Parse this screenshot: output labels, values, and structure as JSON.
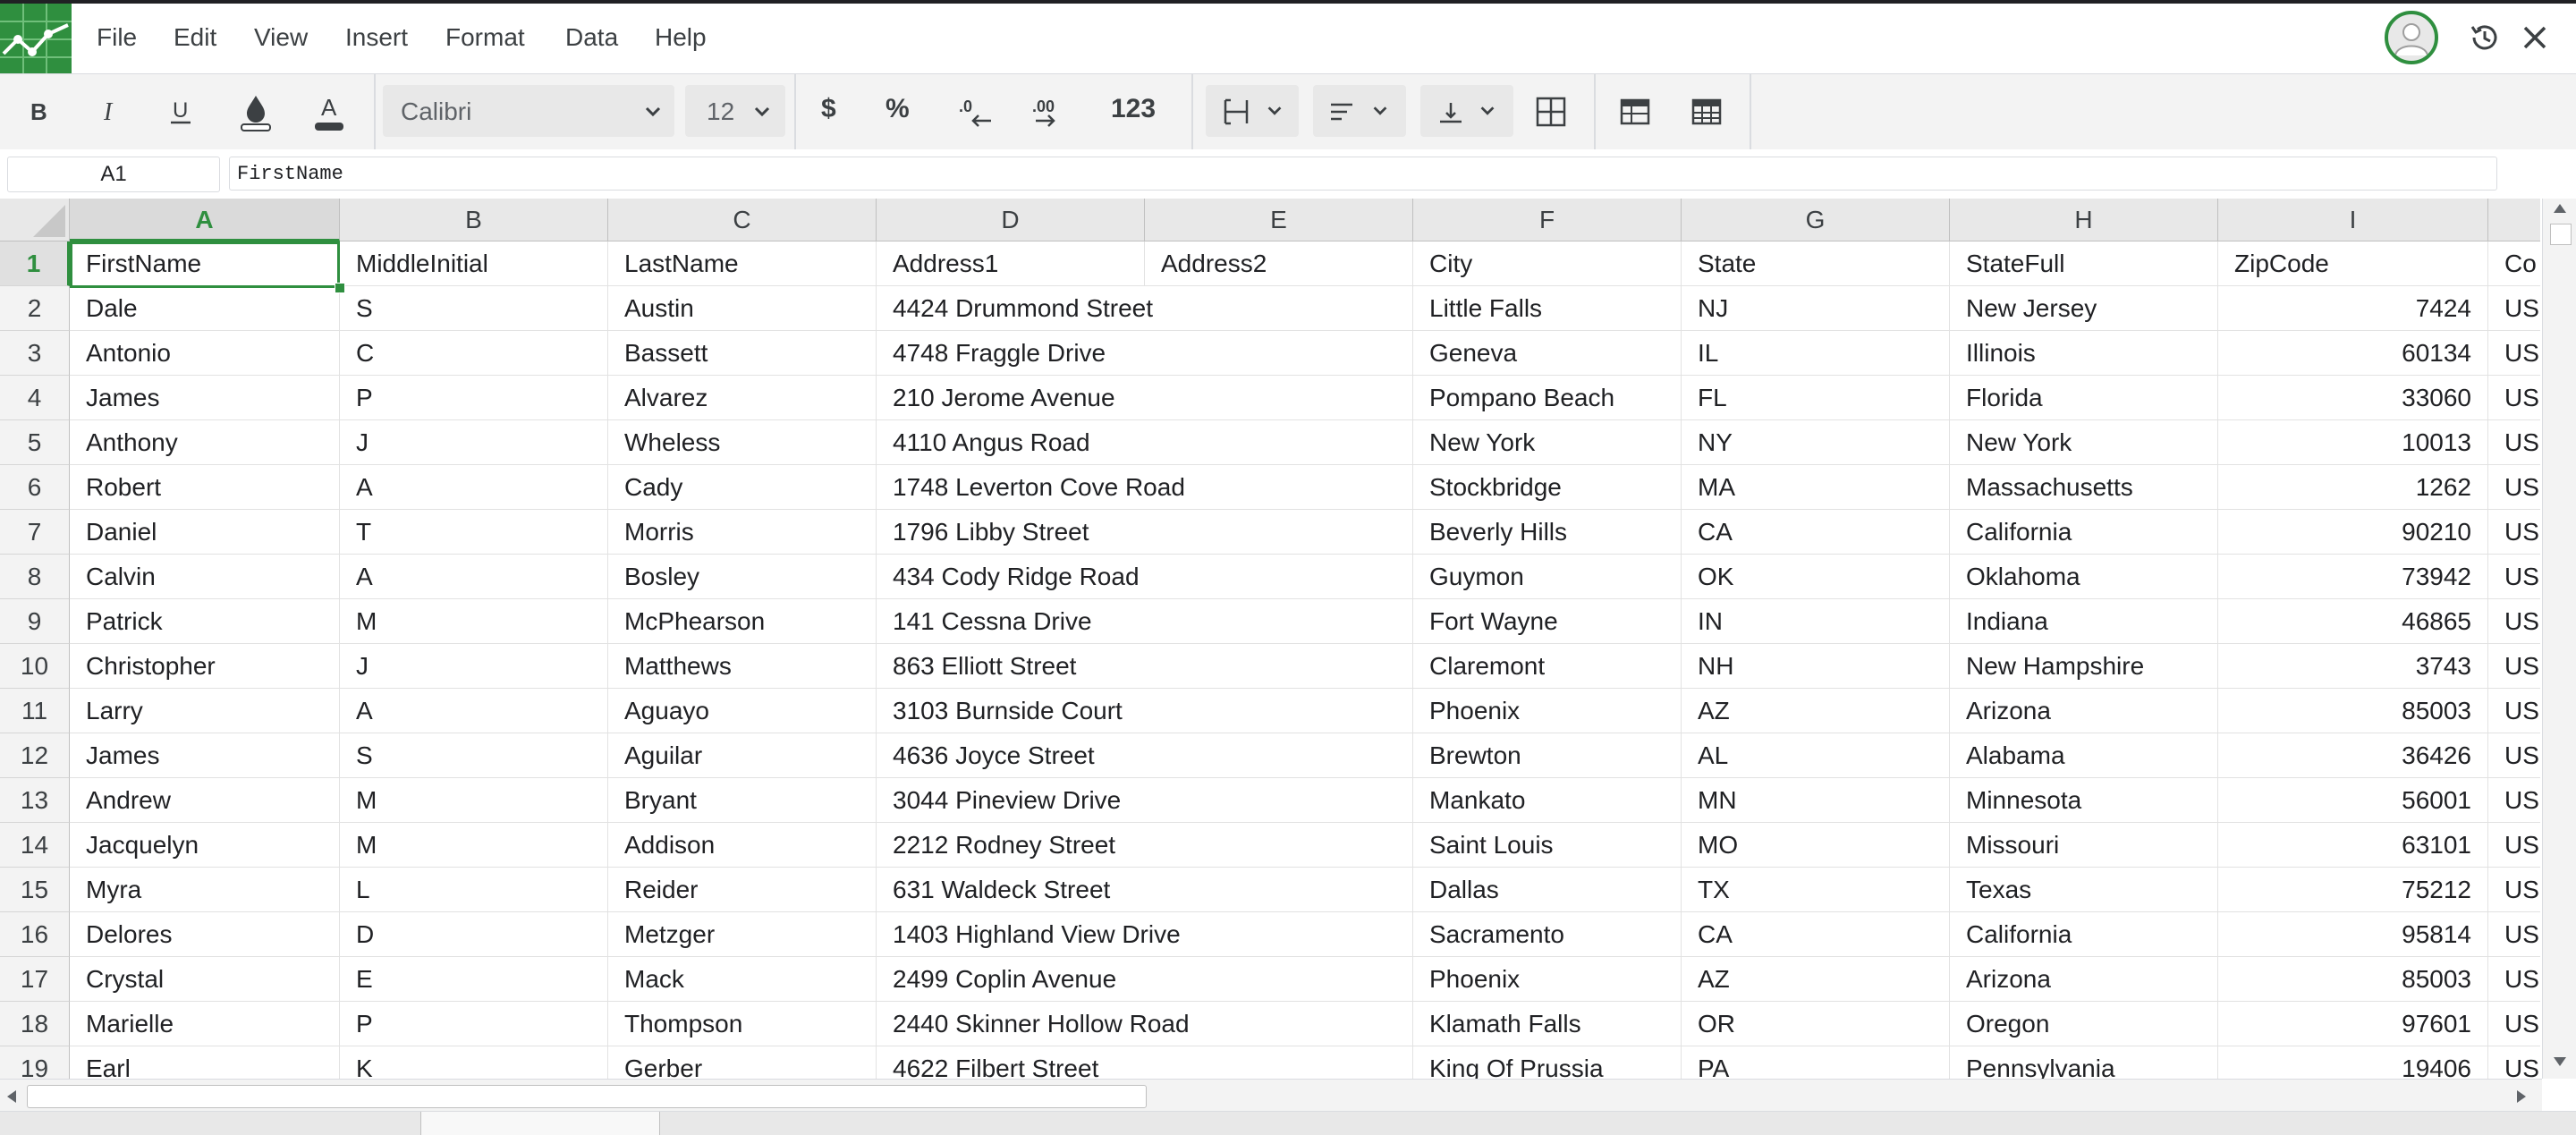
{
  "menu": {
    "items": [
      "File",
      "Edit",
      "View",
      "Insert",
      "Format",
      "Data",
      "Help"
    ]
  },
  "toolbar": {
    "font_name": "Calibri",
    "font_size": "12",
    "currency_label": "$",
    "percent_label": "%",
    "number_format_label": "123"
  },
  "formula_bar": {
    "cell_ref": "A1",
    "content": "FirstName"
  },
  "grid": {
    "columns": [
      "A",
      "B",
      "C",
      "D",
      "E",
      "F",
      "G",
      "H",
      "I"
    ],
    "selected_column": "A",
    "rows": [
      {
        "n": "1",
        "c": [
          "FirstName",
          "MiddleInitial",
          "LastName",
          "Address1",
          "Address2",
          "City",
          "State",
          "StateFull",
          "ZipCode",
          "Co"
        ]
      },
      {
        "n": "2",
        "c": [
          "Dale",
          "S",
          "Austin",
          "4424 Drummond Street",
          "",
          "Little Falls",
          "NJ",
          "New Jersey",
          "7424",
          "US"
        ]
      },
      {
        "n": "3",
        "c": [
          "Antonio",
          "C",
          "Bassett",
          "4748 Fraggle Drive",
          "",
          "Geneva",
          "IL",
          "Illinois",
          "60134",
          "US"
        ]
      },
      {
        "n": "4",
        "c": [
          "James",
          "P",
          "Alvarez",
          "210 Jerome Avenue",
          "",
          "Pompano Beach",
          "FL",
          "Florida",
          "33060",
          "US"
        ]
      },
      {
        "n": "5",
        "c": [
          "Anthony",
          "J",
          "Wheless",
          "4110 Angus Road",
          "",
          "New York",
          "NY",
          "New York",
          "10013",
          "US"
        ]
      },
      {
        "n": "6",
        "c": [
          "Robert",
          "A",
          "Cady",
          "1748 Leverton Cove Road",
          "",
          "Stockbridge",
          "MA",
          "Massachusetts",
          "1262",
          "US"
        ]
      },
      {
        "n": "7",
        "c": [
          "Daniel",
          "T",
          "Morris",
          "1796 Libby Street",
          "",
          "Beverly Hills",
          "CA",
          "California",
          "90210",
          "US"
        ]
      },
      {
        "n": "8",
        "c": [
          "Calvin",
          "A",
          "Bosley",
          "434 Cody Ridge Road",
          "",
          "Guymon",
          "OK",
          "Oklahoma",
          "73942",
          "US"
        ]
      },
      {
        "n": "9",
        "c": [
          "Patrick",
          "M",
          "McPhearson",
          "141 Cessna Drive",
          "",
          "Fort Wayne",
          "IN",
          "Indiana",
          "46865",
          "US"
        ]
      },
      {
        "n": "10",
        "c": [
          "Christopher",
          "J",
          "Matthews",
          "863 Elliott Street",
          "",
          "Claremont",
          "NH",
          "New Hampshire",
          "3743",
          "US"
        ]
      },
      {
        "n": "11",
        "c": [
          "Larry",
          "A",
          "Aguayo",
          "3103 Burnside Court",
          "",
          "Phoenix",
          "AZ",
          "Arizona",
          "85003",
          "US"
        ]
      },
      {
        "n": "12",
        "c": [
          "James",
          "S",
          "Aguilar",
          "4636 Joyce Street",
          "",
          "Brewton",
          "AL",
          "Alabama",
          "36426",
          "US"
        ]
      },
      {
        "n": "13",
        "c": [
          "Andrew",
          "M",
          "Bryant",
          "3044 Pineview Drive",
          "",
          "Mankato",
          "MN",
          "Minnesota",
          "56001",
          "US"
        ]
      },
      {
        "n": "14",
        "c": [
          "Jacquelyn",
          "M",
          "Addison",
          "2212 Rodney Street",
          "",
          "Saint Louis",
          "MO",
          "Missouri",
          "63101",
          "US"
        ]
      },
      {
        "n": "15",
        "c": [
          "Myra",
          "L",
          "Reider",
          "631 Waldeck Street",
          "",
          "Dallas",
          "TX",
          "Texas",
          "75212",
          "US"
        ]
      },
      {
        "n": "16",
        "c": [
          "Delores",
          "D",
          "Metzger",
          "1403 Highland View Drive",
          "",
          "Sacramento",
          "CA",
          "California",
          "95814",
          "US"
        ]
      },
      {
        "n": "17",
        "c": [
          "Crystal",
          "E",
          "Mack",
          "2499 Coplin Avenue",
          "",
          "Phoenix",
          "AZ",
          "Arizona",
          "85003",
          "US"
        ]
      },
      {
        "n": "18",
        "c": [
          "Marielle",
          "P",
          "Thompson",
          "2440 Skinner Hollow Road",
          "",
          "Klamath Falls",
          "OR",
          "Oregon",
          "97601",
          "US"
        ]
      },
      {
        "n": "19",
        "c": [
          "Earl",
          "K",
          "Gerber",
          "4622 Filbert Street",
          "",
          "King Of Prussia",
          "PA",
          "Pennsylvania",
          "19406",
          "US"
        ]
      }
    ]
  },
  "colors": {
    "accent": "#2f8f3f",
    "toolbar_bg": "#f3f3f3",
    "header_bg": "#e8e8e8"
  }
}
